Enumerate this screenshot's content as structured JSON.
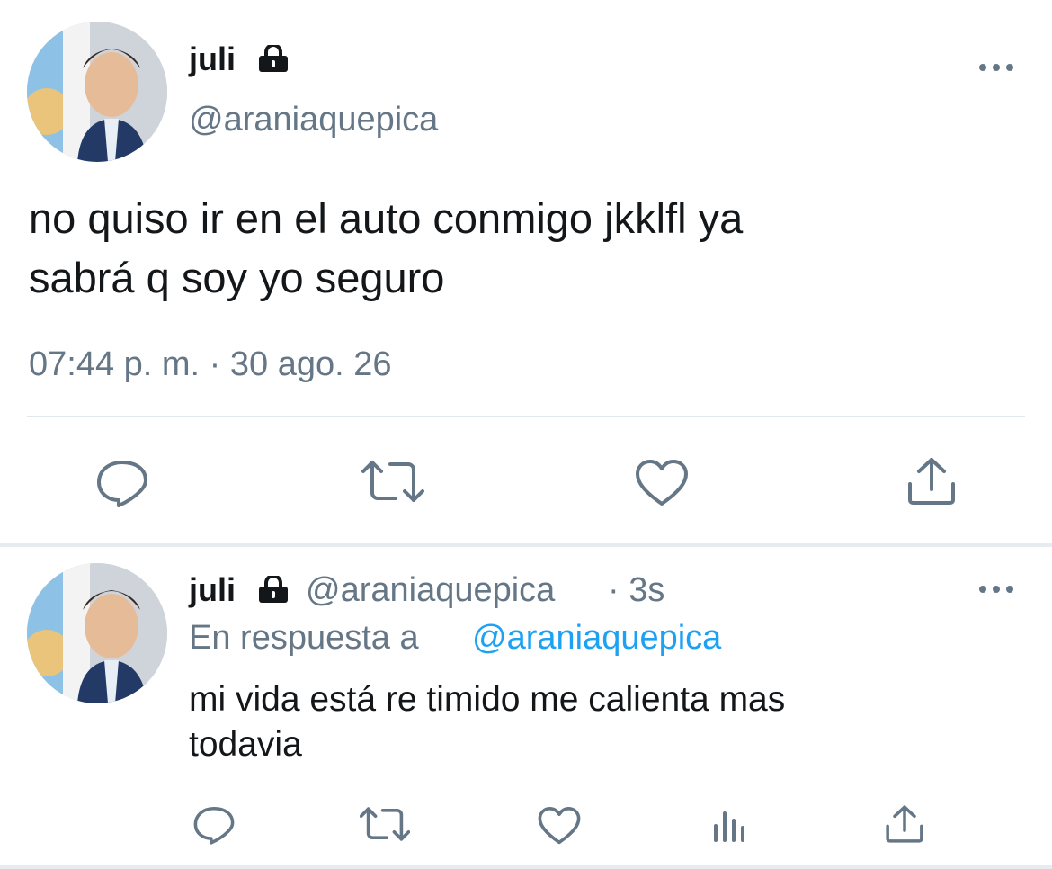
{
  "main_tweet": {
    "display_name": "juli",
    "handle": "@araniaquepica",
    "text_line1": "no quiso ir en el auto conmigo jkklfl ya",
    "text_line2": "sabrá q soy yo seguro",
    "timestamp": "07:44 p. m. · 30 ago. 26",
    "locked": true,
    "actions": [
      "reply-icon",
      "retweet-icon",
      "like-icon",
      "share-icon"
    ]
  },
  "reply_tweet": {
    "display_name": "juli",
    "handle": "@araniaquepica",
    "age": "· 3s",
    "reply_prefix": "En respuesta a",
    "reply_to": "@araniaquepica",
    "text_line1": "mi vida está re timido me calienta mas",
    "text_line2": "todavia",
    "locked": true,
    "actions": [
      "reply-icon",
      "retweet-icon",
      "like-icon",
      "analytics-icon",
      "share-icon"
    ]
  },
  "colors": {
    "text": "#14171a",
    "muted": "#657786",
    "link": "#1da1f2",
    "divider": "#e1e8ed"
  }
}
